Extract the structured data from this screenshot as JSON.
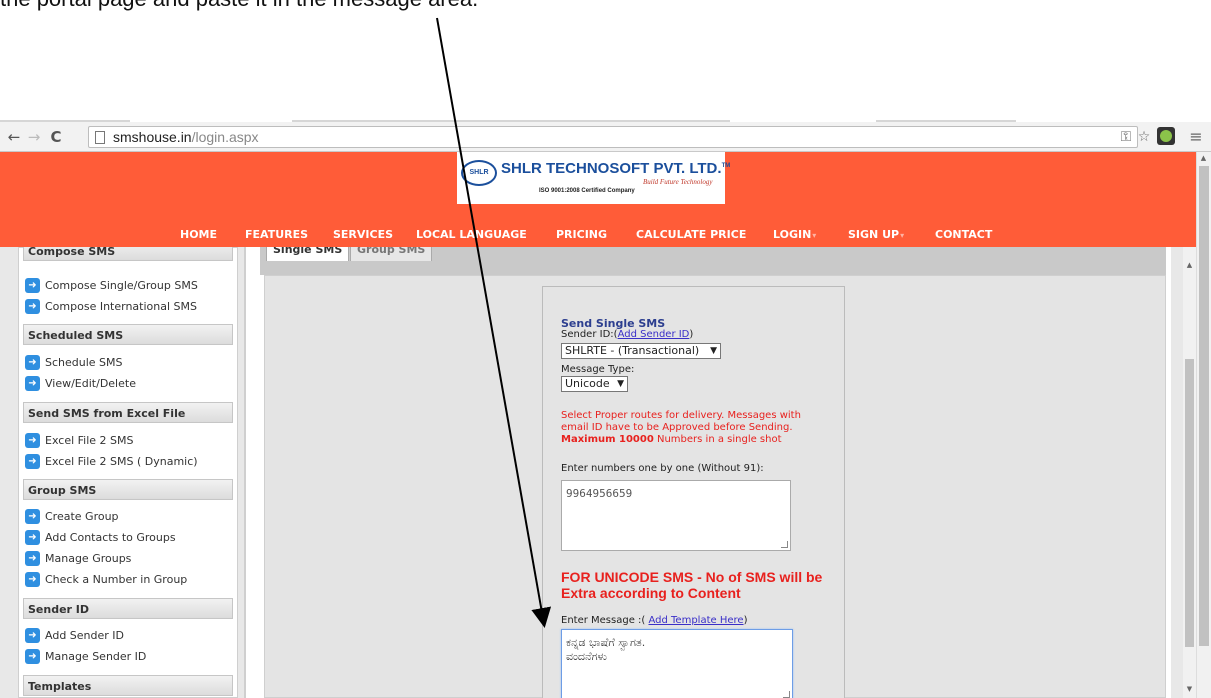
{
  "caption": "the portal page and paste it in the message area.",
  "browser": {
    "url_host": "smshouse.in",
    "url_path": "/login.aspx"
  },
  "site": {
    "logo": {
      "oval_text": "SHLR",
      "name": "SHLR TECHNOSOFT PVT. LTD.",
      "tm": "TM",
      "tagline": "Build Future Technology",
      "iso": "ISO 9001:2008 Certified Company"
    },
    "nav": [
      {
        "label": "HOME",
        "dropdown": false
      },
      {
        "label": "FEATURES",
        "dropdown": false
      },
      {
        "label": "SERVICES",
        "dropdown": false
      },
      {
        "label": "LOCAL LANGUAGE",
        "dropdown": false
      },
      {
        "label": "PRICING",
        "dropdown": false
      },
      {
        "label": "CALCULATE PRICE",
        "dropdown": false
      },
      {
        "label": "LOGIN",
        "dropdown": true
      },
      {
        "label": "SIGN UP",
        "dropdown": true
      },
      {
        "label": "CONTACT",
        "dropdown": false
      }
    ],
    "header_color": "#ff5c38"
  },
  "sidebar": {
    "sections": [
      {
        "title": "Compose SMS",
        "items": [
          "Compose Single/Group SMS",
          "Compose International SMS"
        ]
      },
      {
        "title": "Scheduled SMS",
        "items": [
          "Schedule SMS",
          "View/Edit/Delete"
        ]
      },
      {
        "title": "Send SMS from Excel File",
        "items": [
          "Excel File 2 SMS",
          "Excel File 2 SMS ( Dynamic)"
        ]
      },
      {
        "title": "Group SMS",
        "items": [
          "Create Group",
          "Add Contacts to Groups",
          "Manage Groups",
          "Check a Number in Group"
        ]
      },
      {
        "title": "Sender ID",
        "items": [
          "Add Sender ID",
          "Manage Sender ID"
        ]
      },
      {
        "title": "Templates",
        "items": []
      }
    ]
  },
  "tabs": [
    {
      "label": "Single SMS",
      "active": true
    },
    {
      "label": "Group SMS",
      "active": false
    }
  ],
  "form": {
    "title": "Send Single SMS",
    "sender_label": "Sender ID:",
    "sender_link": "Add Sender ID",
    "sender_value": "SHLRTE - (Transactional)",
    "msgtype_label": "Message Type:",
    "msgtype_value": "Unicode",
    "warn_text": "Select Proper routes for delivery. Messages with email ID have to be Approved before Sending.",
    "warn_bold": "Maximum 10000",
    "warn_tail": " Numbers in a single shot",
    "numbers_label": "Enter numbers one by one (Without 91):",
    "numbers_value": "9964956659",
    "unicode_note": "FOR UNICODE SMS - No of SMS will be Extra according to Content",
    "message_label": "Enter Message :(",
    "message_link": "Add Template Here",
    "message_close": ")",
    "message_line1": "ಕನ್ನಡ ಭಾಷೆಗೆ ಸ್ವಾಗತ.",
    "message_line2": "ವಂದನೆಗಳು"
  }
}
